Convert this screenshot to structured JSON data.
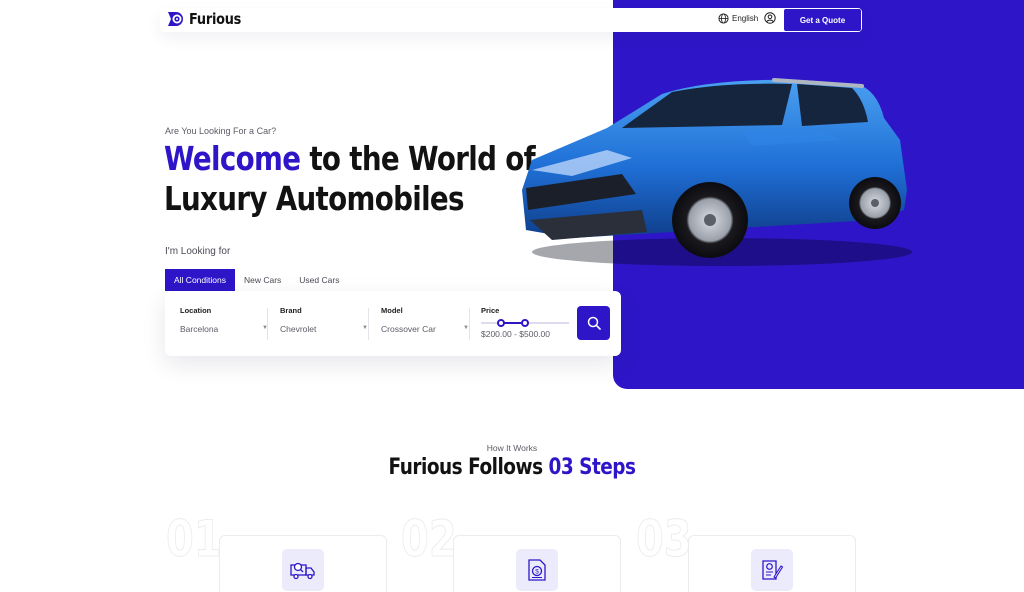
{
  "brand": {
    "name": "Furious"
  },
  "header": {
    "language": "English",
    "quote_label": "Get a Quote"
  },
  "hero": {
    "eyebrow": "Are You Looking For a Car?",
    "title_accent": "Welcome",
    "title_rest_line1": " to the World of",
    "title_line2": "Luxury Automobiles",
    "looking_label": "I'm Looking for",
    "tabs": [
      {
        "label": "All Conditions",
        "active": true
      },
      {
        "label": "New Cars",
        "active": false
      },
      {
        "label": "Used Cars",
        "active": false
      }
    ]
  },
  "search": {
    "location": {
      "label": "Location",
      "value": "Barcelona"
    },
    "brand": {
      "label": "Brand",
      "value": "Chevrolet"
    },
    "model": {
      "label": "Model",
      "value": "Crossover Car"
    },
    "price": {
      "label": "Price",
      "value": "$200.00 - $500.00",
      "range_low_fraction": 0.23,
      "range_high_fraction": 0.5
    }
  },
  "how": {
    "eyebrow": "How It Works",
    "title_main": "Furious Follows ",
    "title_accent": "03 Steps",
    "steps": [
      {
        "number": "01",
        "icon": "delivery-truck-search-icon"
      },
      {
        "number": "02",
        "icon": "document-price-icon"
      },
      {
        "number": "03",
        "icon": "certificate-sign-icon"
      }
    ]
  },
  "colors": {
    "accent": "#2e16c8",
    "accent_soft": "#ecebfb",
    "text": "#121212"
  },
  "icons": {
    "logo": "wheel-logo-icon",
    "globe": "globe-icon",
    "user": "user-icon",
    "search": "search-icon",
    "caret": "chevron-down-icon"
  }
}
